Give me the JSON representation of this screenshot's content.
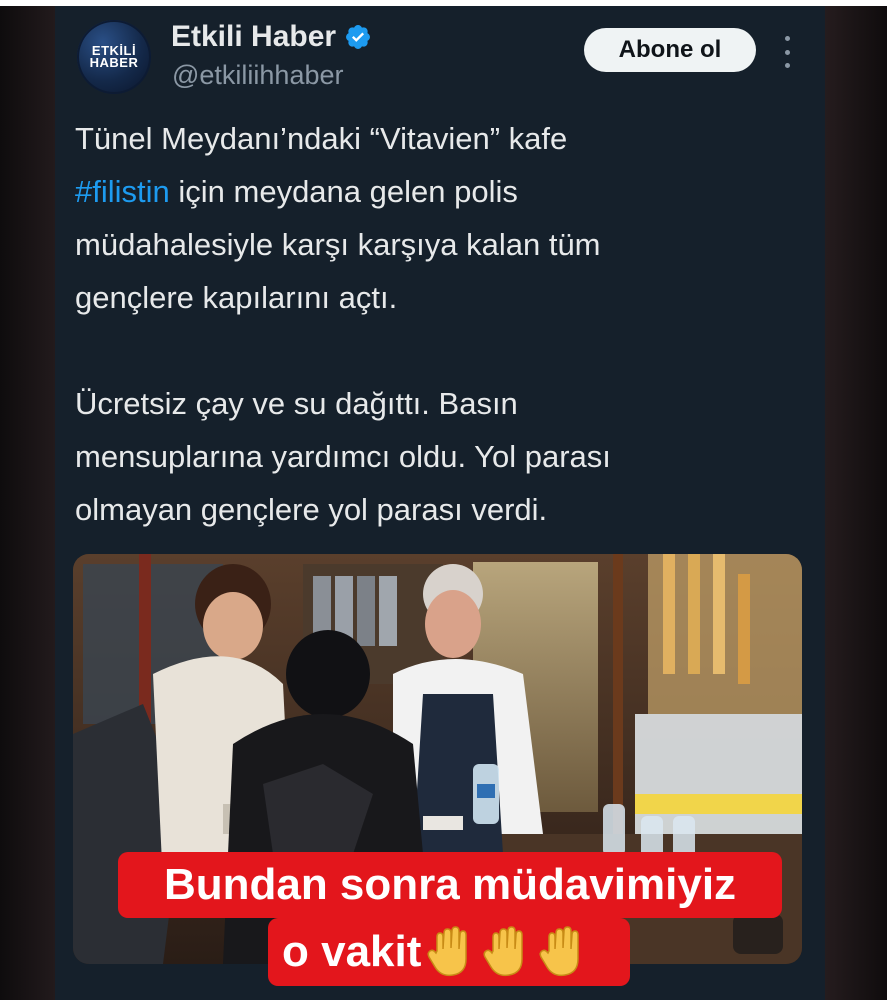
{
  "tweet": {
    "avatar_text_line1": "ETKİLİ",
    "avatar_text_line2": "HABER",
    "display_name": "Etkili Haber",
    "handle": "@etkiliihhaber",
    "follow_label": "Abone ol",
    "verified_color": "#1d9bf0",
    "text_lines_p1": [
      "Tünel Meydanı’ndaki “Vitavien” kafe",
      "#filistin",
      " için meydana gelen polis",
      "müdahalesiyle karşı karşıya kalan tüm",
      "gençlere kapılarını açtı."
    ],
    "text_lines_p2": [
      "Ücretsiz çay ve su dağıttı. Basın",
      "mensuplarına yardımcı oldu. Yol parası",
      "olmayan gençlere yol parası verdi."
    ]
  },
  "caption": {
    "line1": "Bundan sonra müdavimiyiz",
    "line2": "o vakit",
    "icon": "raised-hand-icon",
    "accent": "#e3161c"
  },
  "colors": {
    "card_bg": "#15202b",
    "text": "#e7e9ea",
    "muted": "#8b98a5",
    "link": "#1d9bf0"
  }
}
